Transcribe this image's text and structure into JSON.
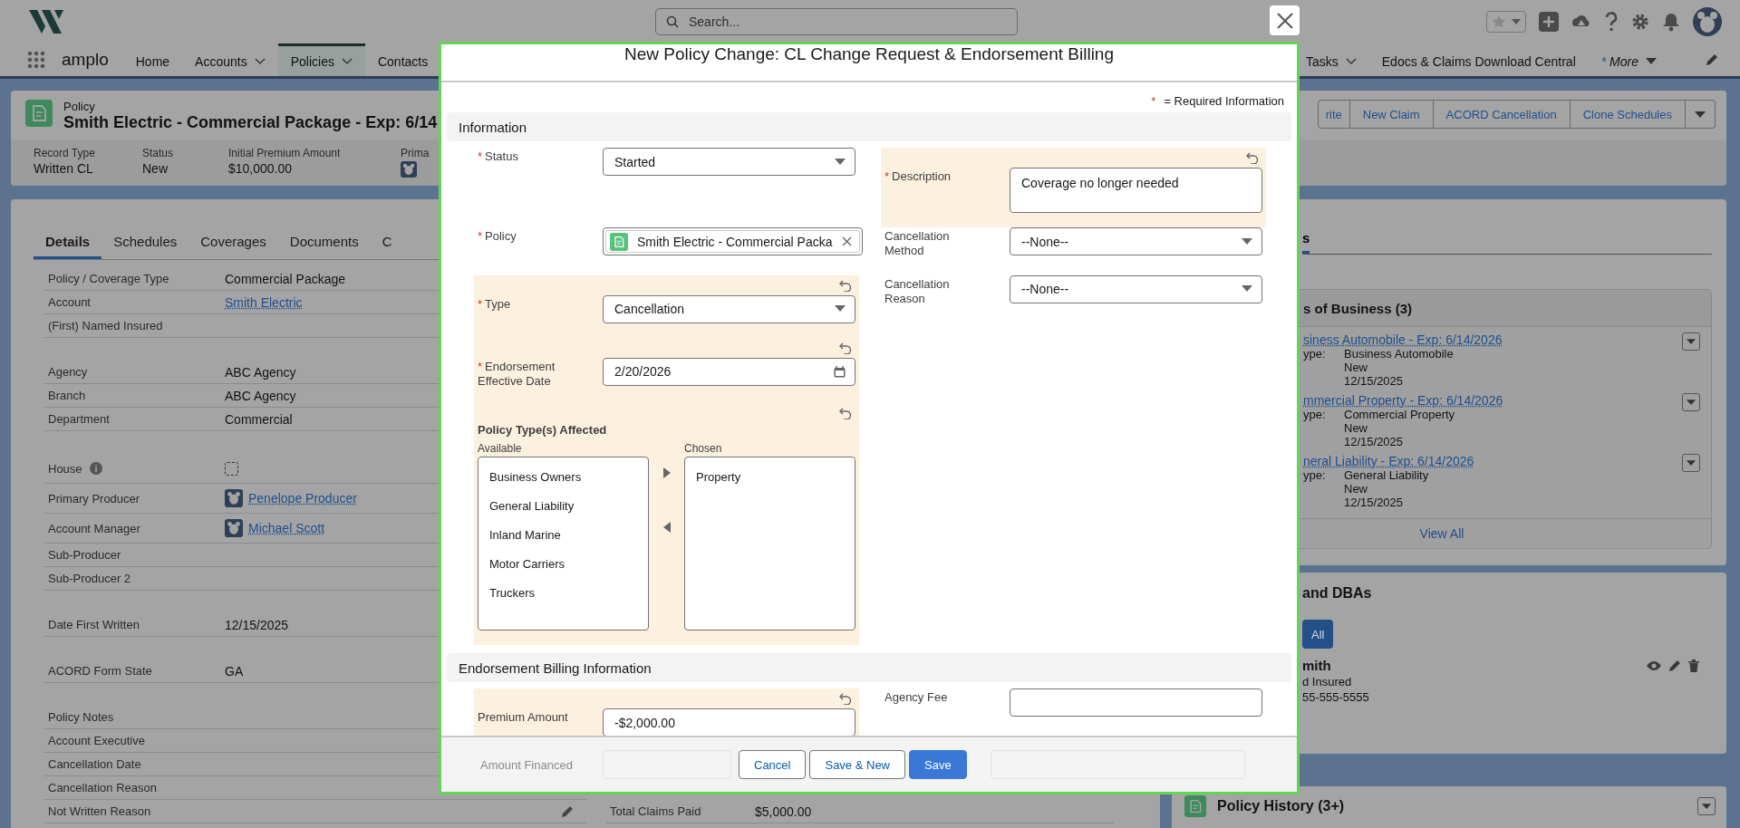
{
  "header": {
    "search": {
      "placeholder": "Search..."
    }
  },
  "nav": {
    "app_name": "amplo",
    "left_items": [
      {
        "label": "Home",
        "selected": false,
        "menu": false
      },
      {
        "label": "Accounts",
        "selected": false,
        "menu": true
      },
      {
        "label": "Policies",
        "selected": true,
        "menu": true
      },
      {
        "label": "Contacts",
        "selected": false,
        "menu": false
      }
    ],
    "right_items": [
      {
        "label": "Tasks",
        "selected": false,
        "menu": true,
        "kind": "tab"
      },
      {
        "label": "Edocs & Claims Download Central",
        "selected": false,
        "menu": false,
        "kind": "tab"
      },
      {
        "label": "More",
        "mark": "*",
        "selected": false,
        "menu": true,
        "kind": "more"
      }
    ]
  },
  "record": {
    "object_type": "Policy",
    "title": "Smith Electric - Commercial Package - Exp: 6/14",
    "actions": [
      "rite",
      "New Claim",
      "ACORD Cancellation",
      "Clone Schedules"
    ],
    "fields": [
      {
        "label": "Record Type",
        "value": "Written CL",
        "kind": "text"
      },
      {
        "label": "Status",
        "value": "New",
        "kind": "text"
      },
      {
        "label": "Initial Premium Amount",
        "value": "$10,000.00",
        "kind": "text"
      },
      {
        "label": "Prima",
        "kind": "user"
      }
    ]
  },
  "details": {
    "tabs": [
      {
        "label": "Details",
        "selected": true
      },
      {
        "label": "Schedules",
        "selected": false
      },
      {
        "label": "Coverages",
        "selected": false
      },
      {
        "label": "Documents",
        "selected": false
      },
      {
        "label": "C",
        "selected": false
      }
    ],
    "sections": [
      [
        {
          "label": "Policy / Coverage Type",
          "kind": "text",
          "value": "Commercial Package"
        },
        {
          "label": "Account",
          "kind": "link",
          "value": "Smith Electric"
        },
        {
          "label": "(First) Named Insured",
          "kind": "empty"
        }
      ],
      [
        {
          "label": "Agency",
          "kind": "text",
          "value": "ABC Agency"
        },
        {
          "label": "Branch",
          "kind": "text",
          "value": "ABC Agency"
        },
        {
          "label": "Department",
          "kind": "text",
          "value": "Commercial"
        }
      ],
      [
        {
          "label": "House",
          "kind": "checkbox",
          "help": true,
          "checked": false
        },
        {
          "label": "Primary Producer",
          "kind": "user",
          "value": "Penelope Producer"
        },
        {
          "label": "Account Manager",
          "kind": "user",
          "value": "Michael Scott"
        },
        {
          "label": "Sub-Producer",
          "kind": "empty"
        },
        {
          "label": "Sub-Producer 2",
          "kind": "empty"
        }
      ],
      [
        {
          "label": "Date First Written",
          "kind": "text",
          "value": "12/15/2025"
        }
      ],
      [
        {
          "label": "ACORD Form State",
          "kind": "text",
          "value": "GA"
        }
      ],
      [
        {
          "label": "Policy Notes",
          "kind": "empty"
        },
        {
          "label": "Account Executive",
          "kind": "empty"
        },
        {
          "label": "Cancellation Date",
          "kind": "empty"
        },
        {
          "label": "Cancellation Reason",
          "kind": "empty"
        },
        {
          "label": "Not Written Reason",
          "kind": "empty",
          "editable": true,
          "aside": {
            "label": "Total Claims Paid",
            "value": "$5,000.00"
          }
        }
      ]
    ]
  },
  "related": {
    "tabs": [
      {
        "label": "s",
        "selected": true
      }
    ],
    "lob": {
      "title": "s of Business (3)",
      "items": [
        {
          "link": "siness Automobile - Exp: 6/14/2026",
          "type_label": "ype:",
          "type": "Business Automobile",
          "status": "New",
          "date": "12/15/2025"
        },
        {
          "link": "mmercial Property - Exp: 6/14/2026",
          "type_label": "ype:",
          "type": "Commercial Property",
          "status": "New",
          "date": "12/15/2025"
        },
        {
          "link": "neral Liability - Exp: 6/14/2026",
          "type_label": "ype:",
          "type": "General Liability",
          "status": "New",
          "date": "12/15/2025"
        }
      ],
      "view_all": "View All"
    },
    "dba": {
      "title": "and DBAs",
      "button": "All",
      "contact": {
        "name": "mith",
        "role": "d Insured",
        "phone": "55-555-5555"
      }
    },
    "history": {
      "title": "Policy History (3+)"
    }
  },
  "modal": {
    "title": "New Policy Change: CL Change Request & Endorsement Billing",
    "required_mark": "*",
    "required_note": "= Required Information",
    "sections": [
      {
        "title": "Information",
        "left": [
          {
            "kind": "select",
            "label": "Status",
            "mark": "*",
            "value": "Started",
            "edited": false
          },
          {
            "kind": "lookup",
            "label": "Policy",
            "mark": "*",
            "value": "Smith Electric - Commercial Packa",
            "edited": false
          },
          {
            "kind": "select",
            "label": "Type",
            "mark": "*",
            "value": "Cancellation",
            "edited": true
          },
          {
            "kind": "date",
            "label": "Endorsement Effective Date",
            "mark": "*",
            "value": "2/20/2026",
            "edited": true
          },
          {
            "kind": "dual_list",
            "label": "Policy Type(s) Affected",
            "edited": true,
            "available_label": "Available",
            "chosen_label": "Chosen",
            "available": [
              "Business Owners",
              "General Liability",
              "Inland Marine",
              "Motor Carriers",
              "Truckers"
            ],
            "chosen": [
              "Property"
            ]
          }
        ],
        "right": [
          {
            "kind": "textarea",
            "label": "Description",
            "mark": "*",
            "value": "Coverage no longer needed",
            "edited": true
          },
          {
            "kind": "select",
            "label": "Cancellation Method",
            "value": "--None--",
            "edited": false
          },
          {
            "kind": "select",
            "label": "Cancellation Reason",
            "value": "--None--",
            "edited": false
          }
        ]
      },
      {
        "title": "Endorsement Billing Information",
        "left": [
          {
            "kind": "text",
            "label": "Premium Amount",
            "value": "-$2,000.00",
            "edited": true
          }
        ],
        "right": [
          {
            "kind": "text",
            "label": "Agency Fee",
            "edited": false
          }
        ]
      }
    ],
    "faded_label": "Amount Financed",
    "buttons": [
      {
        "label": "Cancel",
        "kind": "neutral"
      },
      {
        "label": "Save & New",
        "kind": "neutral"
      },
      {
        "label": "Save",
        "kind": "brand"
      }
    ]
  }
}
